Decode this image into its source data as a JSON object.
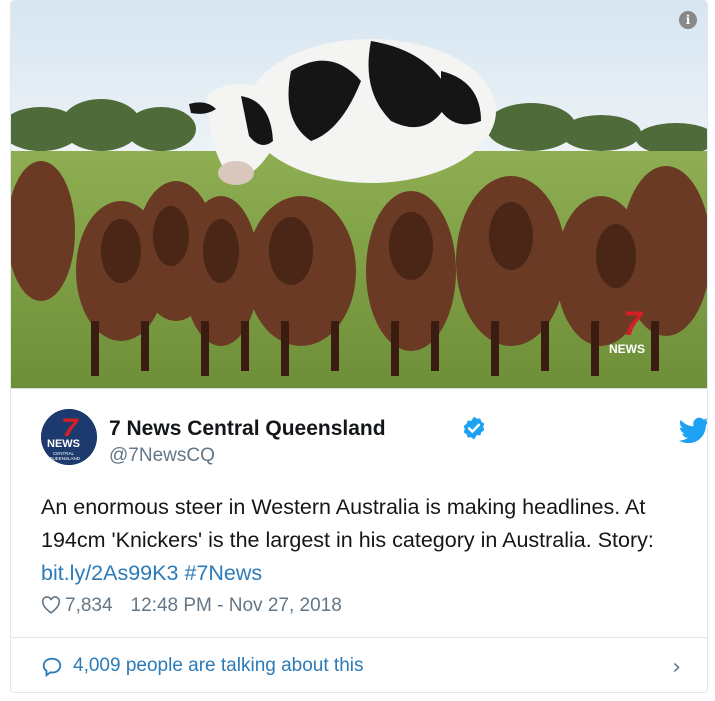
{
  "tweet": {
    "author_name": "7 News Central Queensland",
    "handle": "@7NewsCQ",
    "avatar_brand": "NEWS",
    "avatar_sub": "CENTRAL QUEENSLAND",
    "text_main": "An enormous steer in Western Australia is making headlines. At 194cm 'Knickers' is the largest in his category in Australia. Story: ",
    "link": "bit.ly/2As99K3",
    "hashtag": "#7News",
    "likes": "7,834",
    "timestamp": "12:48 PM - Nov 27, 2018",
    "talking": "4,009 people are talking about this"
  },
  "media": {
    "watermark_num": "7",
    "watermark_text": "NEWS",
    "info_icon": "i"
  },
  "colors": {
    "link": "#2b7bb9",
    "verified": "#1da1f2",
    "twitter_bird": "#1da1f2",
    "text_secondary": "#657786"
  },
  "icons": [
    "info-icon",
    "verified-badge-icon",
    "twitter-bird-icon",
    "heart-icon",
    "speech-bubble-icon",
    "chevron-right-icon"
  ]
}
